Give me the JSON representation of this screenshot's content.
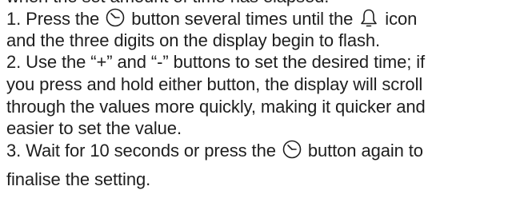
{
  "document": {
    "intro_line": "when the set amount of time has elapsed.",
    "step1": {
      "part_a": "1. Press the ",
      "icon_button": "timer-clock-icon",
      "part_b": " button several times until the ",
      "icon_indicator": "bell-icon",
      "part_c": " icon",
      "line2": "and the three digits on the display begin to flash."
    },
    "step2": {
      "line1": "2. Use the “+” and “-” buttons to set the desired time; if",
      "line2": "you press and hold either button, the display will scroll",
      "line3": "through the values more quickly, making it quicker and",
      "line4": "easier to set the value."
    },
    "step3": {
      "part_a": "3. Wait for 10 seconds or press the ",
      "icon_button": "timer-clock-icon",
      "part_b": " button again to",
      "line2": "finalise the setting."
    }
  }
}
